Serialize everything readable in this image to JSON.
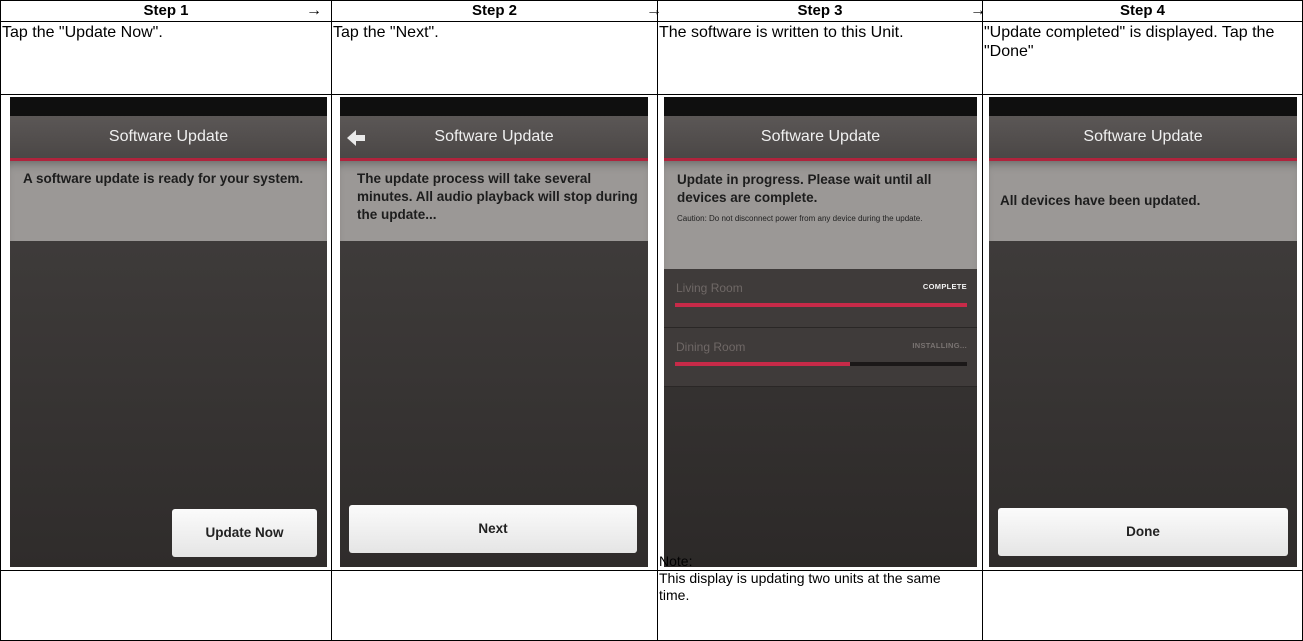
{
  "steps": [
    {
      "header": "Step 1",
      "description": "Tap the \"Update Now\".",
      "note": ""
    },
    {
      "header": "Step 2",
      "description": "Tap the \"Next\".",
      "note": ""
    },
    {
      "header": "Step 3",
      "description": "The software is written to this Unit.",
      "note": "Note:\nThis display is  updating two units at the same time."
    },
    {
      "header": "Step 4",
      "description": "\"Update completed\" is displayed. Tap the \"Done\"",
      "note": ""
    }
  ],
  "arrow": "→",
  "screens": {
    "screen1": {
      "title": "Software Update",
      "message": "A software update is ready for your system.",
      "button": "Update Now"
    },
    "screen2": {
      "title": "Software Update",
      "message": "The update process will take several minutes. All audio playback will stop during the update...",
      "button": "Next",
      "back_icon": "back-arrow-icon"
    },
    "screen3": {
      "title": "Software Update",
      "message": "Update in progress. Please wait until all devices are complete.",
      "caution": "Caution: Do not disconnect power from any device during the update.",
      "devices": [
        {
          "name": "Living Room",
          "status": "COMPLETE",
          "progress": 1.0
        },
        {
          "name": "Dining Room",
          "status": "INSTALLING...",
          "progress": 0.6
        }
      ]
    },
    "screen4": {
      "title": "Software Update",
      "message": "All devices have been updated.",
      "button": "Done"
    }
  },
  "colors": {
    "accent": "#b0233c",
    "progress": "#c72a48",
    "screen_bg": "#3a3736",
    "message_bg": "#9b9896"
  }
}
